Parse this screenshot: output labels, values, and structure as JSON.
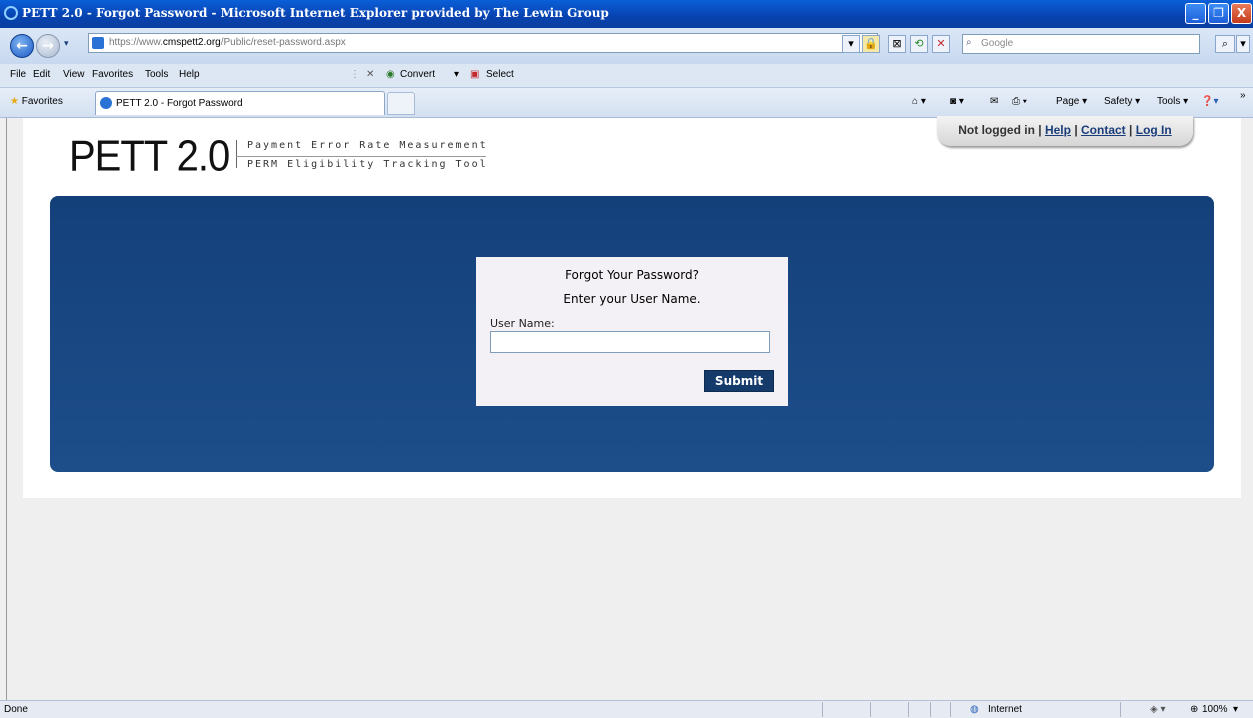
{
  "window": {
    "title": "PETT 2.0 - Forgot Password - Microsoft Internet Explorer provided by The Lewin Group",
    "controls": {
      "minimize": "_",
      "restore": "❐",
      "close": "X"
    }
  },
  "address_bar": {
    "url_prefix": "https://www.",
    "url_domain": "cmspett2.org",
    "url_path": "/Public/reset-password.aspx",
    "search_placeholder": "Google"
  },
  "menu": {
    "items": [
      "File",
      "Edit",
      "View",
      "Favorites",
      "Tools",
      "Help"
    ],
    "convert": "Convert",
    "select": "Select"
  },
  "favorites_bar": {
    "favorites_label": "Favorites",
    "tab_title": "PETT 2.0 - Forgot Password",
    "commands": {
      "page": "Page ▾",
      "safety": "Safety ▾",
      "tools": "Tools ▾"
    }
  },
  "site": {
    "logo": "PETT 2.0",
    "tagline_top": "Payment Error Rate Measurement",
    "tagline_bottom": "PERM Eligibility Tracking Tool",
    "login_status": "Not logged in",
    "links": [
      "Help",
      "Contact",
      "Log In"
    ],
    "separator": "|"
  },
  "form": {
    "heading": "Forgot Your Password?",
    "instruction": "Enter your User Name.",
    "username_label": "User Name:",
    "username_value": "",
    "submit_label": "Submit"
  },
  "status_bar": {
    "left": "Done",
    "zone": "Internet",
    "zoom": "100%"
  },
  "colors": {
    "banner": "#1b4a85",
    "button": "#153b6b",
    "titlebar": "#0a5fd8"
  }
}
